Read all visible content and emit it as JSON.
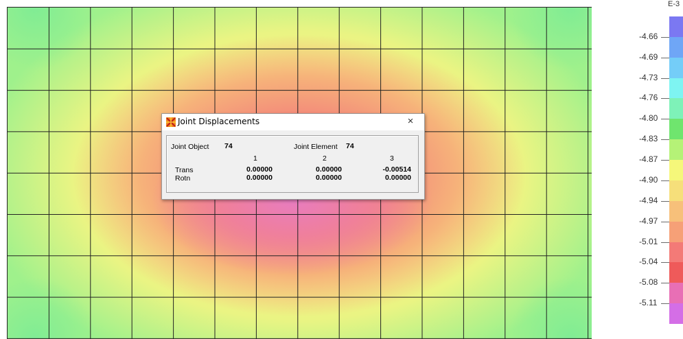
{
  "dialog": {
    "title": "Joint Displacements",
    "joint_object_label": "Joint Object",
    "joint_object_value": "74",
    "joint_element_label": "Joint Element",
    "joint_element_value": "74",
    "columns": [
      "1",
      "2",
      "3"
    ],
    "rows": [
      {
        "label": "Trans",
        "values": [
          "0.00000",
          "0.00000",
          "-0.00514"
        ]
      },
      {
        "label": "Rotn",
        "values": [
          "0.00000",
          "0.00000",
          "0.00000"
        ]
      }
    ],
    "close_symbol": "×",
    "icon": "sap-app-icon"
  },
  "legend": {
    "exponent": "E-3",
    "labels": [
      "-4.66",
      "-4.69",
      "-4.73",
      "-4.76",
      "-4.80",
      "-4.83",
      "-4.87",
      "-4.90",
      "-4.94",
      "-4.97",
      "-5.01",
      "-5.04",
      "-5.08",
      "-5.11"
    ],
    "colors": [
      "#7b78f2",
      "#6fa6f6",
      "#74cdf8",
      "#7ef4f2",
      "#7ef2b8",
      "#6fe56e",
      "#b5f277",
      "#f5f77a",
      "#f6df7a",
      "#f7c07a",
      "#f6a077",
      "#f37a77",
      "#ef5a5a",
      "#e86fb5",
      "#d46ee6"
    ]
  },
  "model": {
    "grid_columns": 14,
    "grid_rows": 8
  }
}
